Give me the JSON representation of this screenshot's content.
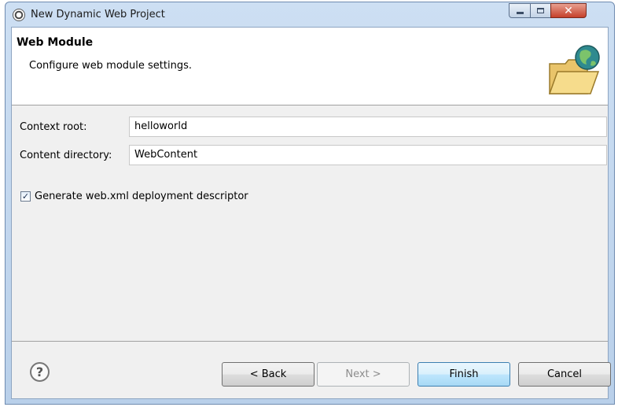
{
  "window": {
    "title": "New Dynamic Web Project",
    "close_glyph": "✕"
  },
  "banner": {
    "title": "Web Module",
    "description": "Configure web module settings.",
    "icon": "folder-globe-icon"
  },
  "form": {
    "context_root_label": "Context root:",
    "context_root_value": "helloworld",
    "content_directory_label": "Content directory:",
    "content_directory_value": "WebContent",
    "generate_descriptor_label": "Generate web.xml deployment descriptor",
    "generate_descriptor_checked": true,
    "check_glyph": "✓"
  },
  "footer": {
    "help_glyph": "?",
    "back_label": "< Back",
    "next_label": "Next >",
    "finish_label": "Finish",
    "cancel_label": "Cancel"
  },
  "colors": {
    "titlebar": "#cddff3",
    "close_button": "#c5402a",
    "finish_accent": "#3c7fb1"
  }
}
